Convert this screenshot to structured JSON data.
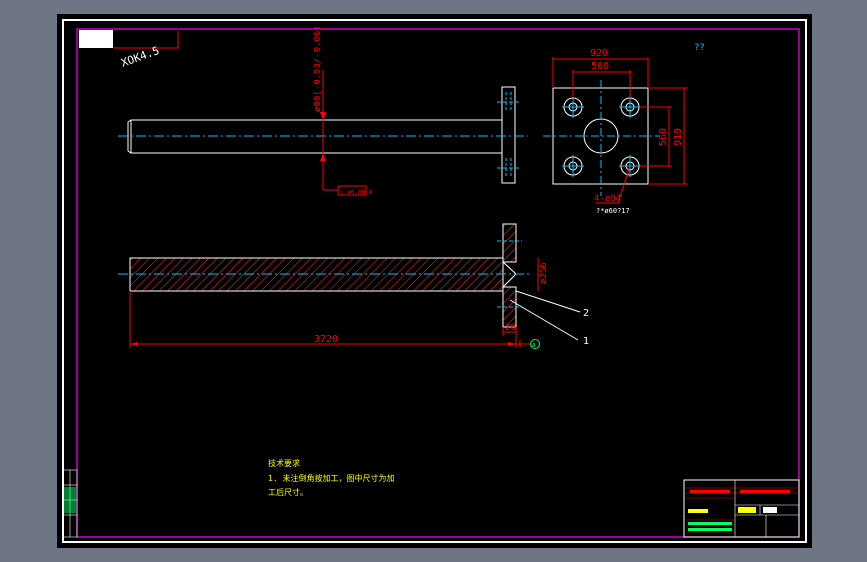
{
  "drawing": {
    "corner_label": "ХОК4.5",
    "top_right_mark": "??",
    "dims": {
      "plate_width_outer": "920",
      "plate_width_inner": "560",
      "plate_height_inner": "560",
      "plate_height_outer": "919",
      "hole_callout": "4-ø84",
      "hole_callout_sub": "?*ø60?17",
      "shaft_diameter": "ø80(-0.03/-0.06)",
      "section_diameter": "ø256",
      "flange_thickness": "20",
      "total_length": "3720"
    },
    "tolerance_frame": "⊥ ø0.08 A",
    "datum_label": "A",
    "leaders": [
      "2",
      "1"
    ]
  },
  "notes": {
    "title": "技术要求",
    "line1": "1. 未注倒角按加工，图中尺寸为加",
    "line2": "工后尺寸。"
  },
  "colors": {
    "background": "#000000",
    "frame": "#ff00ff",
    "outline": "#ffffff",
    "dimension": "#ff0000",
    "centerline": "#00bfff",
    "hatch": "#ff3030",
    "text_yellow": "#ffff00",
    "text_green": "#00ff66"
  }
}
